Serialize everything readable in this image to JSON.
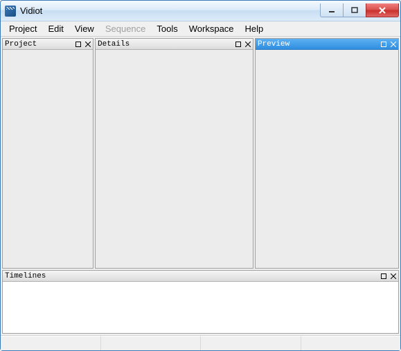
{
  "window": {
    "title": "Vidiot"
  },
  "menubar": {
    "items": [
      {
        "label": "Project",
        "enabled": true
      },
      {
        "label": "Edit",
        "enabled": true
      },
      {
        "label": "View",
        "enabled": true
      },
      {
        "label": "Sequence",
        "enabled": false
      },
      {
        "label": "Tools",
        "enabled": true
      },
      {
        "label": "Workspace",
        "enabled": true
      },
      {
        "label": "Help",
        "enabled": true
      }
    ]
  },
  "panels": {
    "project": {
      "title": "Project",
      "active": false
    },
    "details": {
      "title": "Details",
      "active": false
    },
    "preview": {
      "title": "Preview",
      "active": true
    },
    "timelines": {
      "title": "Timelines",
      "active": false
    }
  }
}
